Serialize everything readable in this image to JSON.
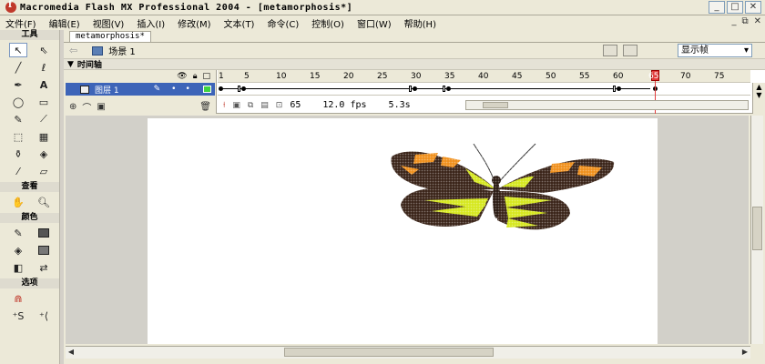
{
  "window": {
    "title": "Macromedia Flash MX Professional 2004 - [metamorphosis*]"
  },
  "menu": [
    "文件(F)",
    "编辑(E)",
    "视图(V)",
    "插入(I)",
    "修改(M)",
    "文本(T)",
    "命令(C)",
    "控制(O)",
    "窗口(W)",
    "帮助(H)"
  ],
  "tools": {
    "header": "工具",
    "view_label": "查看",
    "colors_label": "颜色",
    "options_label": "选项"
  },
  "document": {
    "tab": "metamorphosis*",
    "scene": "场景 1",
    "zoom": "显示帧"
  },
  "timeline": {
    "header": "时间轴",
    "layer_name": "图层 1",
    "ruler_ticks": [
      "1",
      "5",
      "10",
      "15",
      "20",
      "25",
      "30",
      "35",
      "40",
      "45",
      "50",
      "55",
      "60",
      "65",
      "70",
      "75"
    ],
    "current_frame": "65",
    "fps": "12.0 fps",
    "time": "5.3s"
  },
  "colors": {
    "layer_selected": "#3d64b8",
    "playhead": "#e23c3c",
    "wing_dark": "#3a2418",
    "wing_orange": "#f0901c",
    "wing_yellow": "#d6e81e"
  }
}
